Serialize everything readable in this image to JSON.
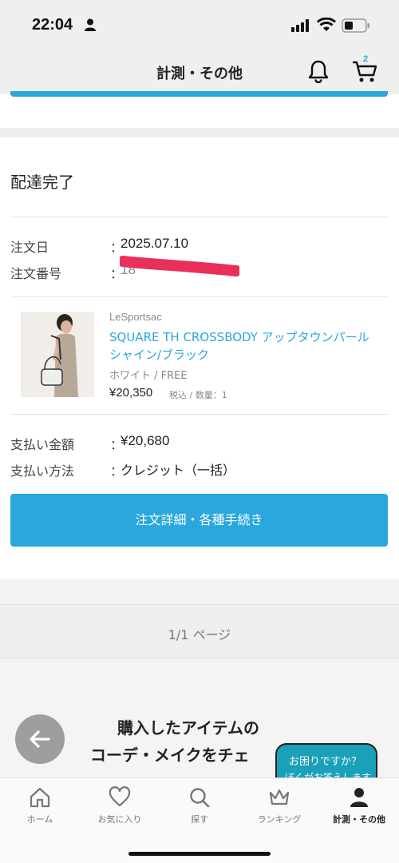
{
  "status_bar": {
    "time": "22:04"
  },
  "header": {
    "title": "計測・その他",
    "cart_count": "2"
  },
  "order": {
    "status": "配達完了",
    "date_label": "注文日",
    "date_value": "2025.07.10",
    "number_label": "注文番号",
    "number_value_visible": "18",
    "colon": "："
  },
  "product": {
    "brand": "LeSportsac",
    "name": "SQUARE TH CROSSBODY アップタウンパールシャイン/ブラック",
    "variant": "ホワイト / FREE",
    "price": "¥20,350",
    "price_note": "税込 / 数量：1"
  },
  "payment": {
    "amount_label": "支払い金額",
    "amount_value": "¥20,680",
    "method_label": "支払い方法",
    "method_value": "クレジット（一括）"
  },
  "detail_button": "注文詳細・各種手続き",
  "pager": {
    "text": "1/1 ページ"
  },
  "promo": {
    "line1": "購入したアイテムの",
    "line2": "コーデ・メイクをチェ"
  },
  "help_bubble": {
    "line1": "お困りですか？",
    "line2": "ぼくがお答えします"
  },
  "tabs": [
    {
      "label": "ホーム",
      "icon": "home-icon",
      "active": false
    },
    {
      "label": "お気に入り",
      "icon": "heart-icon",
      "active": false
    },
    {
      "label": "探す",
      "icon": "search-icon",
      "active": false
    },
    {
      "label": "ランキング",
      "icon": "crown-icon",
      "active": false
    },
    {
      "label": "計測・その他",
      "icon": "person-icon",
      "active": true
    }
  ],
  "colors": {
    "accent": "#2aa7dc",
    "redaction": "#e8305a"
  }
}
